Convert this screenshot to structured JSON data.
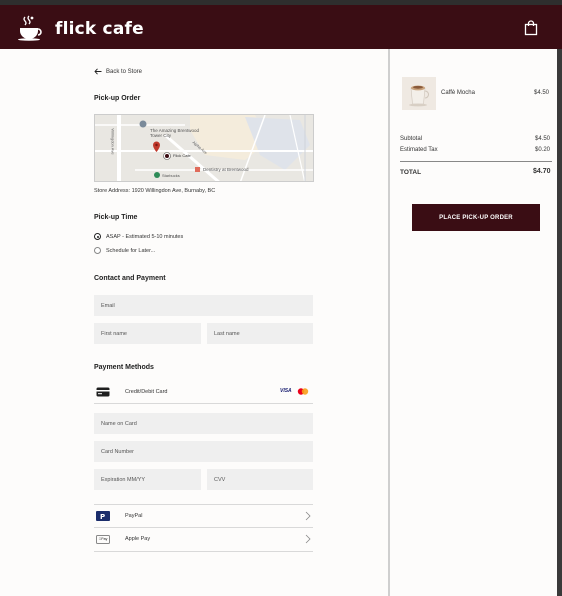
{
  "app": {
    "brand": "flick cafe"
  },
  "checkout": {
    "back_label": "Back to Store",
    "pickup_order_title": "Pick-up Order",
    "map": {
      "place_1": "The Amazing Brentwood Tower City",
      "place_2": "Flick Cafe",
      "place_3": "Dentistry at Brentwood",
      "place_4": "Starbucks",
      "road": "Alpha Ave",
      "road_2": "Willingdon Ave"
    },
    "store_address": "Store Address: 1920 Willingdon Ave, Burnaby, BC",
    "pickup_time_title": "Pick-up Time",
    "pickup_options": [
      {
        "label": "ASAP - Estimated 5-10 minutes",
        "selected": true
      },
      {
        "label": "Schedule for Later...",
        "selected": false
      }
    ],
    "contact_title": "Contact and Payment",
    "email_placeholder": "Email",
    "first_name_placeholder": "First name",
    "last_name_placeholder": "Last name",
    "payment_title": "Payment Methods",
    "card_method": {
      "label": "Credit/Debit Card",
      "brands": [
        "VISA"
      ]
    },
    "name_on_card_placeholder": "Name on Card",
    "card_number_placeholder": "Card Number",
    "expiration_placeholder": "Expiration MM/YY",
    "cvv_placeholder": "CVV",
    "paypal_label": "PayPal",
    "applepay_label": "Apple Pay",
    "applepay_badge": "Pay"
  },
  "summary": {
    "item": {
      "name": "Caffè Mocha",
      "price": "$4.50"
    },
    "subtotal_label": "Subtotal",
    "subtotal_value": "$4.50",
    "tax_label": "Estimated Tax",
    "tax_value": "$0.20",
    "total_label": "TOTAL",
    "total_value": "$4.70",
    "place_order_label": "PLACE PICK-UP ORDER"
  },
  "colors": {
    "brand": "#3a0d14",
    "field_bg": "#efefef"
  }
}
